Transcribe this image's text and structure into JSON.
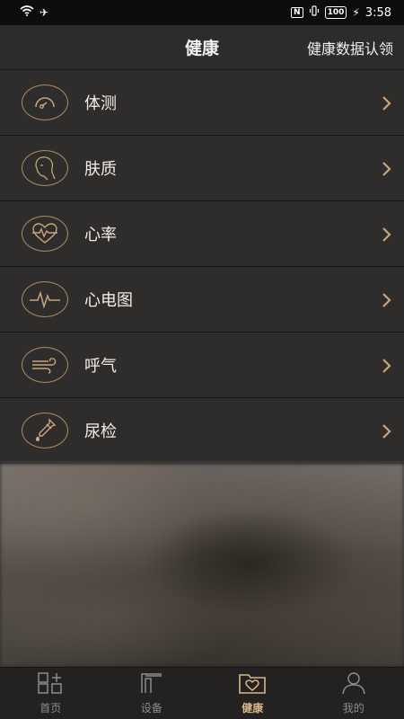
{
  "status_bar": {
    "time": "3:58",
    "battery": "100",
    "nfc": "N"
  },
  "header": {
    "title": "健康",
    "action": "健康数据认领"
  },
  "list": {
    "items": [
      {
        "label": "体测",
        "icon": "gauge-icon"
      },
      {
        "label": "肤质",
        "icon": "face-profile-icon"
      },
      {
        "label": "心率",
        "icon": "heart-pulse-icon"
      },
      {
        "label": "心电图",
        "icon": "ecg-icon"
      },
      {
        "label": "呼气",
        "icon": "breath-icon"
      },
      {
        "label": "尿检",
        "icon": "dropper-icon"
      }
    ]
  },
  "bottom_nav": {
    "items": [
      {
        "label": "首页",
        "icon": "home-grid-icon",
        "active": false
      },
      {
        "label": "设备",
        "icon": "device-icon",
        "active": false
      },
      {
        "label": "健康",
        "icon": "health-folder-icon",
        "active": true
      },
      {
        "label": "我的",
        "icon": "person-icon",
        "active": false
      }
    ]
  },
  "colors": {
    "accent": "#b08a5e",
    "active_tab": "#d8b58a",
    "row_bg": "#2e2d2c",
    "header_bg": "#2d2c2b"
  }
}
